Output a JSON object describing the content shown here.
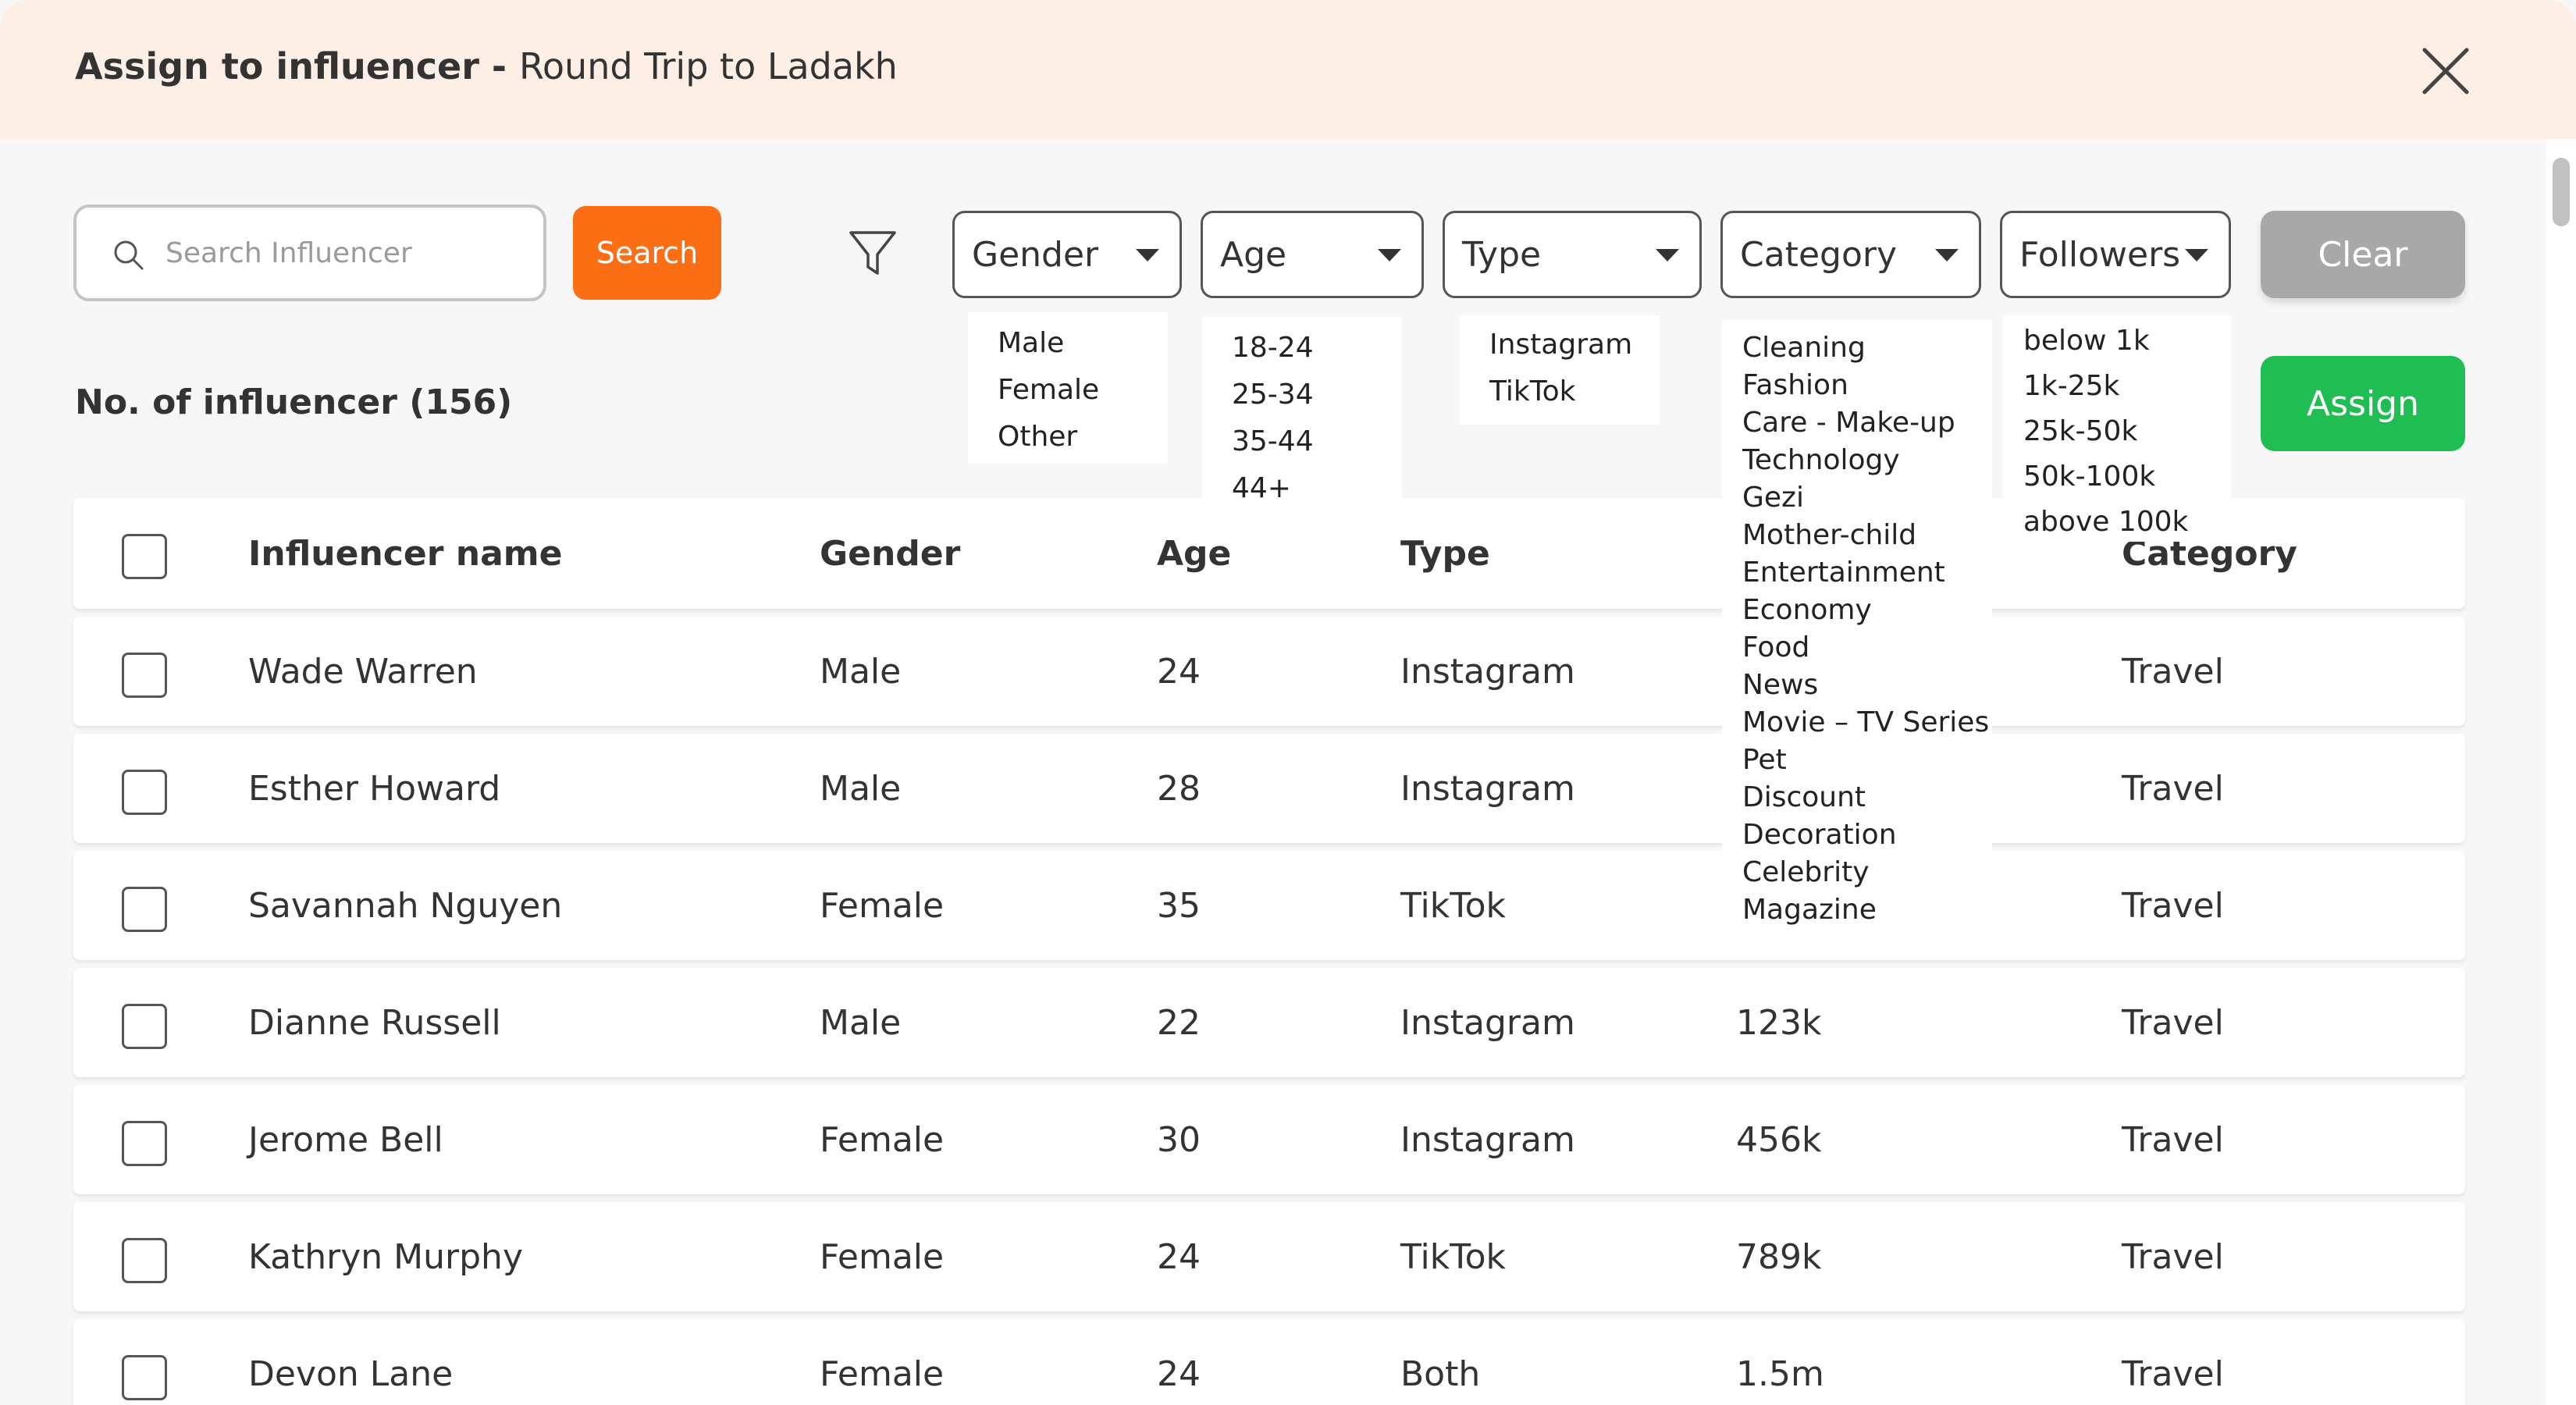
{
  "modal": {
    "title_bold": "Assign to influencer - ",
    "title_rest": "Round Trip to Ladakh"
  },
  "search": {
    "placeholder": "Search Influencer",
    "button_label": "Search"
  },
  "filters": {
    "gender": {
      "label": "Gender",
      "options": [
        "Male",
        "Female",
        "Other"
      ]
    },
    "age": {
      "label": "Age",
      "options": [
        "18-24",
        "25-34",
        "35-44",
        "44+"
      ]
    },
    "type": {
      "label": "Type",
      "options": [
        "Instagram",
        "TikTok"
      ]
    },
    "category": {
      "label": "Category",
      "options": [
        "Cleaning",
        "Fashion",
        "Care - Make-up",
        "Technology",
        "Gezi",
        "Mother-child",
        "Entertainment",
        "Economy",
        "Food",
        "News",
        "Movie – TV Series",
        "Pet",
        "Discount",
        "Decoration",
        "Celebrity",
        "Magazine"
      ]
    },
    "followers": {
      "label": "Followers",
      "options": [
        "below 1k",
        "1k-25k",
        "25k-50k",
        "50k-100k",
        "above 100k"
      ]
    }
  },
  "actions": {
    "clear_label": "Clear",
    "assign_label": "Assign"
  },
  "count_label": "No. of influencer (156)",
  "table": {
    "headers": {
      "name": "Influencer name",
      "gender": "Gender",
      "age": "Age",
      "type": "Type",
      "category": "Category"
    },
    "rows": [
      {
        "name": "Wade Warren",
        "gender": "Male",
        "age": "24",
        "type": "Instagram",
        "followers": "",
        "category": "Travel"
      },
      {
        "name": "Esther Howard",
        "gender": "Male",
        "age": "28",
        "type": "Instagram",
        "followers": "",
        "category": "Travel"
      },
      {
        "name": "Savannah Nguyen",
        "gender": "Female",
        "age": "35",
        "type": "TikTok",
        "followers": "",
        "category": "Travel"
      },
      {
        "name": "Dianne Russell",
        "gender": "Male",
        "age": "22",
        "type": "Instagram",
        "followers": "123k",
        "category": "Travel"
      },
      {
        "name": "Jerome Bell",
        "gender": "Female",
        "age": "30",
        "type": "Instagram",
        "followers": "456k",
        "category": "Travel"
      },
      {
        "name": "Kathryn Murphy",
        "gender": "Female",
        "age": "24",
        "type": "TikTok",
        "followers": "789k",
        "category": "Travel"
      },
      {
        "name": "Devon Lane",
        "gender": "Female",
        "age": "24",
        "type": "Both",
        "followers": "1.5m",
        "category": "Travel"
      }
    ]
  },
  "icons": {
    "search": "search-icon",
    "filter": "filter-icon",
    "close": "close-icon",
    "dropdown": "caret-down-icon"
  },
  "colors": {
    "header_bg": "#fdefe6",
    "search_button": "#fb6e14",
    "assign_button": "#1fbd52",
    "clear_button": "#a8a8a8"
  }
}
